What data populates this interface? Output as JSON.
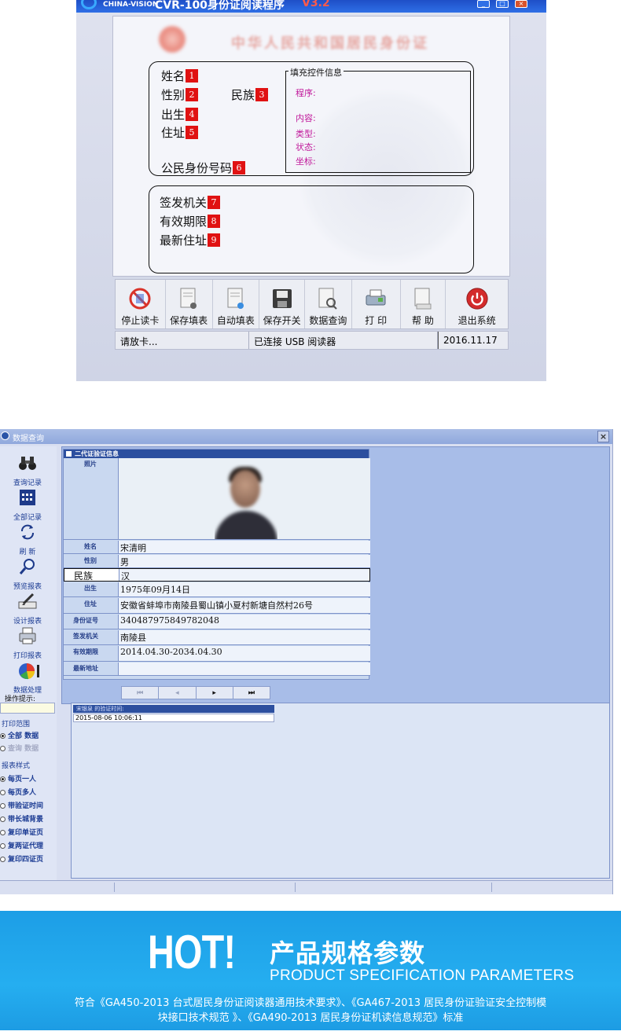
{
  "reader_app": {
    "brand": "CHINA-VISION",
    "title": "CVR-100身份证阅读程序",
    "version": "V3.2",
    "fields": {
      "name_label": "姓名",
      "gender_label": "性别",
      "ethnicity_label": "民族",
      "birth_label": "出生",
      "address_label": "住址",
      "id_number_label": "公民身份号码",
      "authority_label": "签发机关",
      "validity_label": "有效期限",
      "new_address_label": "最新住址"
    },
    "badges": [
      "1",
      "2",
      "3",
      "4",
      "5",
      "6",
      "7",
      "8",
      "9"
    ],
    "fill_panel": {
      "legend": "填充控件信息",
      "program": "程序:",
      "content": "内容:",
      "type": "类型:",
      "status": "状态:",
      "coord": "坐标:"
    },
    "toolbar": [
      "停止读卡",
      "保存填表",
      "自动填表",
      "保存开关",
      "数据查询",
      "打 印",
      "帮 助",
      "退出系统"
    ],
    "status": {
      "left": "请放卡...",
      "middle": "已连接 USB 阅读器",
      "date": "2016.11.17"
    }
  },
  "query_app": {
    "title": "数据查询",
    "close": "×",
    "sidebar": [
      "查询记录",
      "全部记录",
      "刷 新",
      "预览报表",
      "设计报表",
      "打印报表",
      "数据处理"
    ],
    "hint_label": "操作提示:",
    "print_range_title": "打印范围",
    "print_range": [
      "全部 数据",
      "查询 数据"
    ],
    "report_style_title": "报表样式",
    "report_styles": [
      "每页一人",
      "每页多人",
      "带验证时间",
      "带长城背景",
      "复印单证页",
      "复两证代理",
      "复印四证页"
    ],
    "detail_header": "二代证验证信息",
    "photo_label": "照片",
    "rows": [
      {
        "k": "姓名",
        "v": "宋清明"
      },
      {
        "k": "性别",
        "v": "男"
      },
      {
        "k": "民族",
        "v": "汉"
      },
      {
        "k": "出生",
        "v": "1975年09月14日"
      },
      {
        "k": "住址",
        "v": "安徽省蚌埠市南陵县蜀山镇小夏村新塘自然村26号"
      },
      {
        "k": "身份证号",
        "v": "340487975849782048"
      },
      {
        "k": "签发机关",
        "v": "南陵县"
      },
      {
        "k": "有效期限",
        "v": "2014.04.30-2034.04.30"
      },
      {
        "k": "最新地址",
        "v": ""
      }
    ],
    "pager": [
      "⏮",
      "◂",
      "▸",
      "⏭"
    ],
    "lower_header": "宋银泉 的验证时间:",
    "lower_value": "2015-08-06 10:06:11"
  },
  "banner": {
    "hot": "HOT!",
    "title_cn": "产品规格参数",
    "title_en": "PRODUCT SPECIFICATION PARAMETERS",
    "desc_line1": "符合《GA450-2013 台式居民身份证阅读器通用技术要求》、《GA467-2013 居民身份证验证安全控制模",
    "desc_line2": "块接口技术规范 》、《GA490-2013 居民身份证机读信息规范》标准"
  },
  "colors": {
    "badge": "#e01212",
    "titlebar": "#2f6fe6",
    "banner": "#1d9ee6",
    "query_header": "#2c4f9f"
  }
}
